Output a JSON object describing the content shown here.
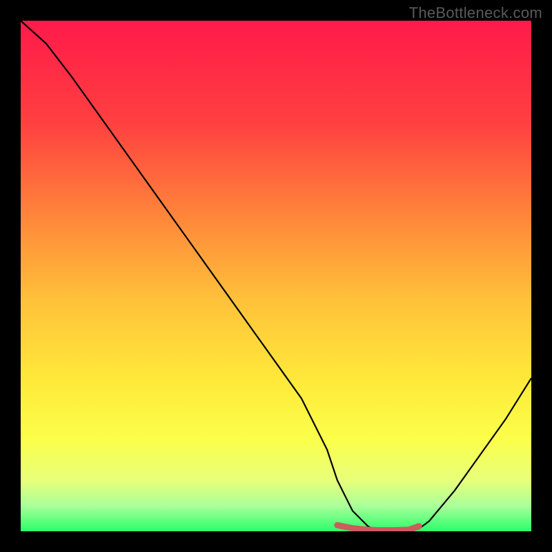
{
  "watermark": "TheBottleneck.com",
  "chart_data": {
    "type": "line",
    "title": "",
    "xlabel": "",
    "ylabel": "",
    "xlim": [
      0,
      100
    ],
    "ylim": [
      0,
      100
    ],
    "x": [
      0,
      5,
      10,
      15,
      20,
      25,
      30,
      35,
      40,
      45,
      50,
      55,
      60,
      62,
      65,
      68,
      70,
      73,
      76,
      78,
      80,
      85,
      90,
      95,
      100
    ],
    "values": [
      100,
      95.5,
      89,
      82,
      75,
      68,
      61,
      54,
      47,
      40,
      33,
      26,
      16,
      10,
      4,
      1,
      0,
      0,
      0,
      0.5,
      2,
      8,
      15,
      22,
      30
    ],
    "highlight_segment": {
      "x": [
        62,
        65,
        68,
        70,
        73,
        76,
        78
      ],
      "values": [
        1.2,
        0.6,
        0.3,
        0.2,
        0.2,
        0.3,
        1.0
      ],
      "color": "#cd5c5c"
    },
    "gradient_stops": [
      {
        "offset": 0,
        "color": "#ff1a4a"
      },
      {
        "offset": 20,
        "color": "#ff4040"
      },
      {
        "offset": 40,
        "color": "#ff8c3a"
      },
      {
        "offset": 55,
        "color": "#ffc23a"
      },
      {
        "offset": 70,
        "color": "#ffe83a"
      },
      {
        "offset": 82,
        "color": "#fbff4a"
      },
      {
        "offset": 90,
        "color": "#e8ff7a"
      },
      {
        "offset": 95,
        "color": "#aaff9a"
      },
      {
        "offset": 100,
        "color": "#2aff6a"
      }
    ]
  }
}
